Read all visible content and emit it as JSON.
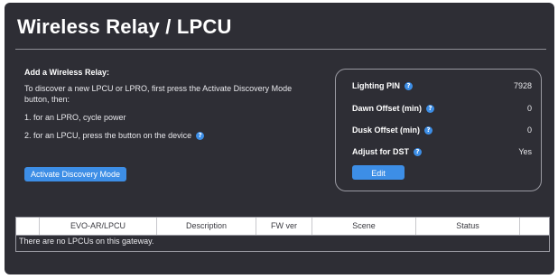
{
  "page": {
    "title": "Wireless Relay / LPCU"
  },
  "add_relay": {
    "heading": "Add a Wireless Relay:",
    "intro_line1": "To discover a new LPCU or LPRO, first press the Activate Discovery Mode",
    "intro_line2": "button, then:",
    "step1": "1. for an LPRO, cycle power",
    "step2": "2. for an LPCU, press the button on the device",
    "help_icon": "question-circle-icon",
    "activate_button": "Activate Discovery Mode"
  },
  "settings": {
    "lighting_pin_label": "Lighting PIN",
    "lighting_pin_value": "7928",
    "dawn_offset_label": "Dawn Offset (min)",
    "dawn_offset_value": "0",
    "dusk_offset_label": "Dusk Offset (min)",
    "dusk_offset_value": "0",
    "adjust_dst_label": "Adjust for DST",
    "adjust_dst_value": "Yes",
    "edit_button": "Edit"
  },
  "table": {
    "columns": [
      "",
      "EVO-AR/LPCU",
      "Description",
      "FW ver",
      "Scene",
      "Status",
      ""
    ],
    "empty_message": "There are no LPCUs on this gateway."
  },
  "colors": {
    "panel_bg": "#2e2e35",
    "accent": "#3d8ee6",
    "text": "#ffffff"
  }
}
